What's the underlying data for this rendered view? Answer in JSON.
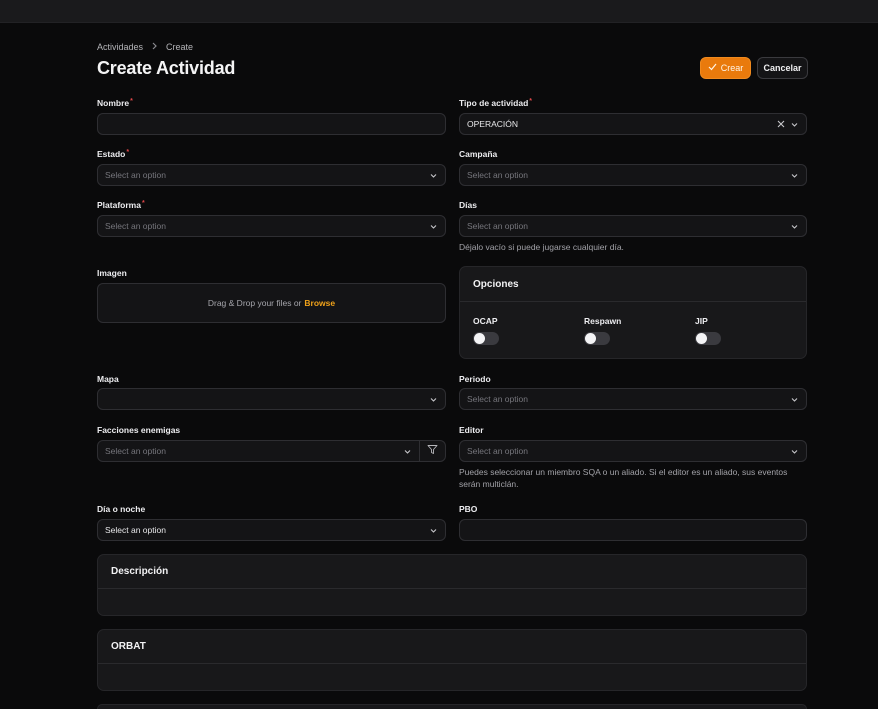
{
  "breadcrumb": {
    "parent": "Actividades",
    "current": "Create"
  },
  "page": {
    "title": "Create Actividad"
  },
  "actions": {
    "create_label": "Crear",
    "cancel_label": "Cancelar"
  },
  "colors": {
    "accent": "#e97a0c",
    "required": "#e0484a",
    "link": "#f0a21a"
  },
  "form": {
    "nombre": {
      "label": "Nombre",
      "value": ""
    },
    "tipo": {
      "label": "Tipo de actividad",
      "value": "OPERACIÓN"
    },
    "estado": {
      "label": "Estado",
      "placeholder": "Select an option"
    },
    "campana": {
      "label": "Campaña",
      "placeholder": "Select an option"
    },
    "plataforma": {
      "label": "Plataforma",
      "placeholder": "Select an option"
    },
    "dias": {
      "label": "Días",
      "placeholder": "Select an option",
      "hint": "Déjalo vacío si puede jugarse cualquier día."
    },
    "imagen": {
      "label": "Imagen",
      "drop_text": "Drag & Drop your files or",
      "browse": "Browse"
    },
    "mapa": {
      "label": "Mapa",
      "value": ""
    },
    "periodo": {
      "label": "Periodo",
      "placeholder": "Select an option"
    },
    "facciones": {
      "label": "Facciones enemigas",
      "placeholder": "Select an option"
    },
    "editor": {
      "label": "Editor",
      "placeholder": "Select an option",
      "hint": "Puedes seleccionar un miembro SQA o un aliado. Si el editor es un aliado, sus eventos serán multiclán."
    },
    "dia_noche": {
      "label": "Día o noche",
      "value": "Select an option"
    },
    "pbo": {
      "label": "PBO",
      "value": ""
    }
  },
  "opciones": {
    "title": "Opciones",
    "toggles": [
      {
        "label": "OCAP",
        "on": false
      },
      {
        "label": "Respawn",
        "on": false
      },
      {
        "label": "JIP",
        "on": false
      }
    ]
  },
  "sections": {
    "descripcion": "Descripción",
    "orbat": "ORBAT"
  },
  "icons": {
    "breadcrumb_sep": "chevron-right-icon",
    "select": "chevron-down-icon",
    "clear": "close-icon",
    "filter": "filter-icon",
    "check": "check-icon"
  }
}
